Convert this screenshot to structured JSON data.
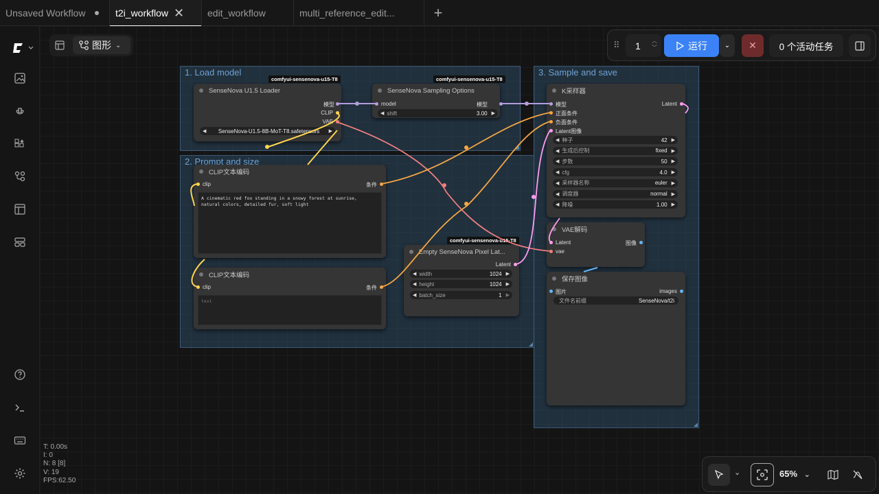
{
  "tabs": [
    {
      "label": "Unsaved Workflow"
    },
    {
      "label": "t2i_workflow"
    },
    {
      "label": "edit_workflow"
    },
    {
      "label": "multi_reference_edit..."
    }
  ],
  "toolbar": {
    "graph_label": "图形",
    "queue_count": "1",
    "run_label": "运行",
    "active_tasks": "0 个活动任务"
  },
  "groups": {
    "g1": "1. Load model",
    "g2": "2. Prompt and size",
    "g3": "3. Sample and save"
  },
  "badges": {
    "loader": "comfyui-sensenova-u15-T8",
    "sampling": "comfyui-sensenova-u15-T8",
    "latent": "comfyui-sensenova-u15-T8"
  },
  "loader": {
    "title": "SenseNova U1.5 Loader",
    "out_model": "模型",
    "out_clip": "CLIP",
    "out_vae": "VAE",
    "ckpt": "SenseNova-U1.5-8B-MoT-T8.safetensors"
  },
  "sampling": {
    "title": "SenseNova Sampling Options",
    "in_model": "model",
    "out_model": "模型",
    "shift_label": "shift",
    "shift_value": "3.00"
  },
  "clip1": {
    "title": "CLIP文本编码",
    "in_clip": "clip",
    "out_cond": "条件",
    "text": "A cinematic red fox standing in a snowy forest at sunrise, natural colors, detailed fur, soft light"
  },
  "clip2": {
    "title": "CLIP文本编码",
    "in_clip": "clip",
    "out_cond": "条件",
    "text": "text"
  },
  "latent": {
    "title": "Empty SenseNova Pixel Lat...",
    "out": "Latent",
    "width_label": "width",
    "width_value": "1024",
    "height_label": "height",
    "height_value": "1024",
    "batch_label": "batch_size",
    "batch_value": "1"
  },
  "ksampler": {
    "title": "K采样器",
    "in_model": "模型",
    "in_pos": "正面条件",
    "in_neg": "负面条件",
    "in_latent": "Latent图像",
    "out_latent": "Latent",
    "widgets": [
      {
        "label": "种子",
        "value": "42"
      },
      {
        "label": "生成后控制",
        "value": "fixed"
      },
      {
        "label": "步数",
        "value": "50"
      },
      {
        "label": "cfg",
        "value": "4.0"
      },
      {
        "label": "采样器名称",
        "value": "euler"
      },
      {
        "label": "调度器",
        "value": "normal"
      },
      {
        "label": "降噪",
        "value": "1.00"
      }
    ]
  },
  "vae": {
    "title": "VAE解码",
    "in_latent": "Latent",
    "in_vae": "vae",
    "out_image": "图像"
  },
  "save": {
    "title": "保存图像",
    "in_images": "图片",
    "out_images": "images",
    "prefix_label": "文件名前缀",
    "prefix_value": "SenseNova/t2i"
  },
  "stats": {
    "t": "T: 0.00s",
    "i": "I: 0",
    "n": "N: 8 [8]",
    "v": "V: 19",
    "fps": "FPS:62.50"
  },
  "zoom": {
    "level": "65%"
  },
  "colors": {
    "accent": "#3b82f6",
    "model": "#b39ddb",
    "clip": "#ffd54f",
    "vae": "#ef7f7f",
    "cond": "#f5a742",
    "latent": "#ff9cf2",
    "image": "#64b5f6",
    "stop": "#7a2a2a"
  }
}
